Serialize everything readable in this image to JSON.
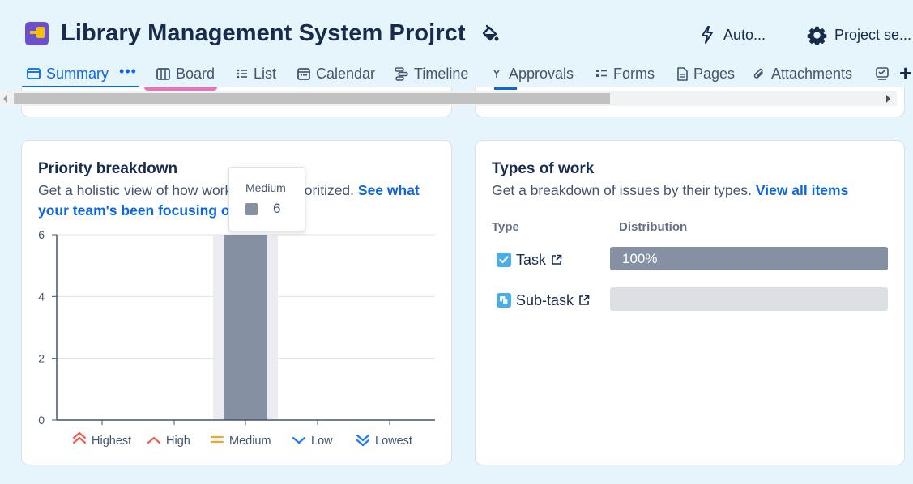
{
  "header": {
    "title": "Library Management System Projrct",
    "automation_label": "Auto...",
    "settings_label": "Project se..."
  },
  "tabs": [
    {
      "label": "Summary",
      "icon": "summary-icon",
      "active": true
    },
    {
      "label": "Board",
      "icon": "board-icon"
    },
    {
      "label": "List",
      "icon": "list-icon"
    },
    {
      "label": "Calendar",
      "icon": "calendar-icon"
    },
    {
      "label": "Timeline",
      "icon": "timeline-icon"
    },
    {
      "label": "Approvals",
      "icon": "approvals-icon"
    },
    {
      "label": "Forms",
      "icon": "forms-icon"
    },
    {
      "label": "Pages",
      "icon": "pages-icon"
    },
    {
      "label": "Attachments",
      "icon": "attachment-icon"
    }
  ],
  "priority": {
    "title": "Priority breakdown",
    "desc_lead": "Get a holistic view of how work is being prioritized. ",
    "desc_link": "See what your team's been focusing on",
    "tooltip": {
      "label": "Medium",
      "value": "6"
    }
  },
  "chart_data": {
    "type": "bar",
    "categories": [
      "Highest",
      "High",
      "Medium",
      "Low",
      "Lowest"
    ],
    "values": [
      0,
      0,
      6,
      0,
      0
    ],
    "ylim": [
      0,
      6
    ],
    "yticks": [
      0,
      2,
      4,
      6
    ],
    "grid": true,
    "legend": "bottom",
    "legend_colors": [
      "#f15b50",
      "#f15b50",
      "#f5a623",
      "#1d7afc",
      "#1d7afc"
    ],
    "highlighted_category": "Medium",
    "bar_color": "#8590a2"
  },
  "types": {
    "title": "Types of work",
    "desc_lead": "Get a breakdown of issues by their types. ",
    "desc_link": "View all items",
    "col_type": "Type",
    "col_dist": "Distribution",
    "rows": [
      {
        "name": "Task",
        "percent": 100,
        "label": "100%",
        "icon": "task-icon",
        "color": "#4bade8"
      },
      {
        "name": "Sub-task",
        "percent": 0,
        "label": "",
        "icon": "subtask-icon",
        "color": "#4bade8"
      }
    ]
  },
  "colors": {
    "accent": "#0c66e4",
    "background": "#e6f4fb",
    "text": "#172b4d"
  }
}
